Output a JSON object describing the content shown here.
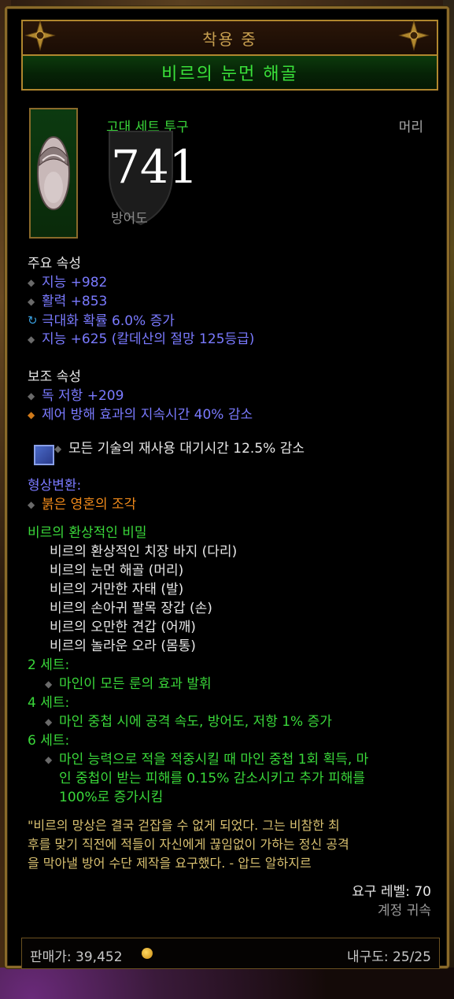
{
  "header": {
    "equipped_label": "착용 중",
    "item_name": "비르의 눈먼 해골"
  },
  "item": {
    "type": "고대 세트 투구",
    "slot": "머리",
    "armor_value": "741",
    "armor_label": "방어도"
  },
  "primary": {
    "title": "주요 속성",
    "stats": [
      "지능 +982",
      "활력 +853",
      "극대화 확률 6.0% 증가",
      "지능 +625 (칼데산의 절망 125등급)"
    ]
  },
  "secondary": {
    "title": "보조 속성",
    "stats": [
      "독 저항 +209",
      "제어 방해 효과의 지속시간 40% 감소"
    ]
  },
  "socket": {
    "text": "모든 기술의 재사용 대기시간 12.5% 감소"
  },
  "transmog": {
    "title": "형상변환:",
    "value": "붉은 영혼의 조각"
  },
  "set": {
    "name": "비르의 환상적인 비밀",
    "pieces": [
      "비르의 환상적인 치장 바지 (다리)",
      "비르의 눈먼 해골 (머리)",
      "비르의 거만한 자태 (발)",
      "비르의 손아귀 팔목 장갑 (손)",
      "비르의 오만한 견갑 (어깨)",
      "비르의 놀라운 오라 (몸통)"
    ],
    "bonuses": [
      {
        "label": "2 세트:",
        "lines": [
          "마인이 모든 룬의 효과 발휘"
        ]
      },
      {
        "label": "4 세트:",
        "lines": [
          "마인 중첩 시에 공격 속도, 방어도, 저항 1% 증가"
        ]
      },
      {
        "label": "6 세트:",
        "lines": [
          "마인 능력으로 적을 적중시킬 때 마인 중첩 1회 획득, 마",
          "인 중첩이 받는 피해를 0.15% 감소시키고 추가 피해를",
          "100%로 증가시킴"
        ]
      }
    ]
  },
  "flavor": {
    "lines": [
      "\"비르의 망상은 결국 걷잡을 수 없게 되었다. 그는 비참한 최",
      "후를 맞기 직전에 적들이 자신에게 끊임없이 가하는 정신 공격",
      "을 막아낼 방어 수단 제작을 요구했다. - 압드 알하지르"
    ]
  },
  "requirements": {
    "level": "요구 레벨: 70",
    "bound": "계정 귀속"
  },
  "footer": {
    "price": "판매가: 39,452",
    "durability": "내구도: 25/25"
  },
  "colors": {
    "set_green": "#3ad83a",
    "magic_blue": "#7a7aff",
    "legendary_orange": "#f08a1a",
    "frame_gold": "#b0872e"
  }
}
